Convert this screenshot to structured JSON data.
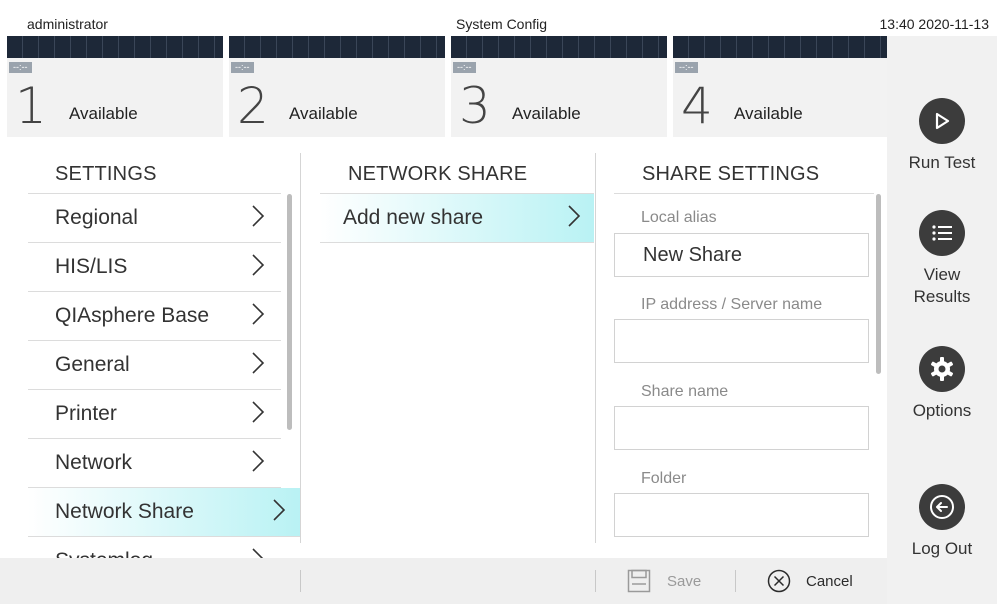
{
  "status_bar": {
    "user": "administrator",
    "title": "System Config",
    "clock": "13:40 2020-11-13"
  },
  "modules": [
    {
      "dash": "--:--",
      "number": "1",
      "status": "Available"
    },
    {
      "dash": "--:--",
      "number": "2",
      "status": "Available"
    },
    {
      "dash": "--:--",
      "number": "3",
      "status": "Available"
    },
    {
      "dash": "--:--",
      "number": "4",
      "status": "Available"
    }
  ],
  "sidebar": {
    "run_test": "Run Test",
    "view_results_line1": "View",
    "view_results_line2": "Results",
    "options": "Options",
    "log_out": "Log Out"
  },
  "settings": {
    "title": "SETTINGS",
    "items": [
      {
        "label": "Regional"
      },
      {
        "label": "HIS/LIS"
      },
      {
        "label": "QIAsphere Base"
      },
      {
        "label": "General"
      },
      {
        "label": "Printer"
      },
      {
        "label": "Network"
      },
      {
        "label": "Network Share",
        "selected": true
      },
      {
        "label": "Systemlog"
      }
    ]
  },
  "network_share": {
    "title": "NETWORK SHARE",
    "items": [
      {
        "label": "Add new share",
        "selected": true
      }
    ]
  },
  "share_settings": {
    "title": "SHARE SETTINGS",
    "fields": [
      {
        "label": "Local alias",
        "value": "New Share"
      },
      {
        "label": "IP address / Server name",
        "value": ""
      },
      {
        "label": "Share name",
        "value": ""
      },
      {
        "label": "Folder",
        "value": ""
      }
    ]
  },
  "bottom_bar": {
    "save": "Save",
    "cancel": "Cancel"
  },
  "colors": {
    "selection_gradient_end": "#b9f2f4",
    "module_bar": "#1d2838",
    "sidebar_icon": "#3c3c3c"
  }
}
